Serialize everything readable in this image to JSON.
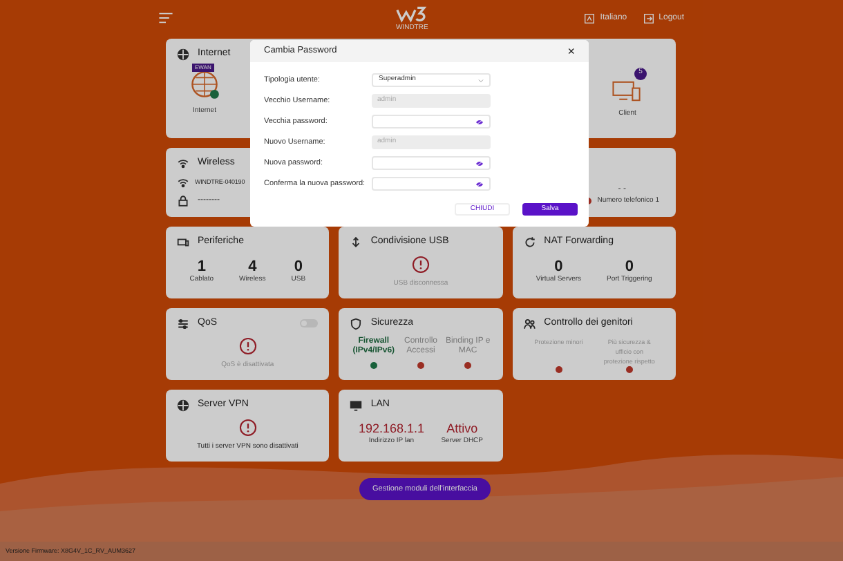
{
  "header": {
    "logo_caption": "WINDTRE",
    "language": "Italiano",
    "logout": "Logout"
  },
  "cards": [
    {
      "kind": "internet",
      "title": "Internet",
      "internet_label": "Internet",
      "internet_badge": "EWAN",
      "client_label": "Client",
      "client_count": "5"
    },
    {
      "kind": "wireless",
      "title": "Wireless",
      "ssid": "WINDTRE-040190",
      "password": "--------",
      "phone_value": "- -",
      "phone_label": "Numero telefonico 1",
      "phone_active": false
    },
    {
      "kind": "stats",
      "title": "Periferiche",
      "accent": false,
      "items": [
        {
          "value": "1",
          "label": "Cablato"
        },
        {
          "value": "4",
          "label": "Wireless"
        },
        {
          "value": "0",
          "label": "USB"
        }
      ]
    },
    {
      "kind": "alert",
      "title": "Condivisione USB",
      "message": "USB disconnessa",
      "muted": true
    },
    {
      "kind": "stats",
      "title": "NAT Forwarding",
      "accent": false,
      "items": [
        {
          "value": "0",
          "label": "Virtual Servers"
        },
        {
          "value": "0",
          "label": "Port Triggering"
        }
      ]
    },
    {
      "kind": "alert",
      "title": "QoS",
      "message": "QoS è disattivata",
      "muted": true,
      "toggle_on": false
    },
    {
      "kind": "status",
      "title": "Sicurezza",
      "items": [
        {
          "label": "Firewall (IPv4/IPv6)",
          "active": true
        },
        {
          "label": "Controllo Accessi",
          "active": false
        },
        {
          "label": "Binding IP e MAC",
          "active": false
        }
      ]
    },
    {
      "kind": "status",
      "title": "Controllo dei genitori",
      "items": [
        {
          "label": "Protezione minori",
          "active": false
        },
        {
          "label": "Più sicurezza & ufficio con protezione rispetto",
          "active": false
        }
      ]
    },
    {
      "kind": "alert",
      "title": "Server VPN",
      "message": "Tutti i server VPN sono disattivati",
      "muted": false
    },
    {
      "kind": "stats",
      "title": "LAN",
      "accent": true,
      "items": [
        {
          "value": "192.168.1.1",
          "label": "Indirizzo IP lan"
        },
        {
          "value": "Attivo",
          "label": "Server DHCP"
        }
      ]
    }
  ],
  "manage_button": "Gestione moduli dell'interfaccia",
  "footer": "Versione Firmware: X8G4V_1C_RV_AUM3627",
  "dialog": {
    "title": "Cambia Password",
    "close": "×",
    "fields": [
      {
        "kind": "select",
        "label": "Tipologia utente:",
        "value": "Superadmin"
      },
      {
        "kind": "readonly",
        "label": "Vecchio Username:",
        "value": "admin"
      },
      {
        "kind": "password",
        "label": "Vecchia password:"
      },
      {
        "kind": "readonly",
        "label": "Nuovo Username:",
        "value": "admin"
      },
      {
        "kind": "password",
        "label": "Nuova password:"
      },
      {
        "kind": "password",
        "label": "Conferma la nuova password:"
      }
    ],
    "buttons": [
      {
        "label": "CHIUDI",
        "primary": false
      },
      {
        "label": "Salva",
        "primary": true
      }
    ]
  }
}
